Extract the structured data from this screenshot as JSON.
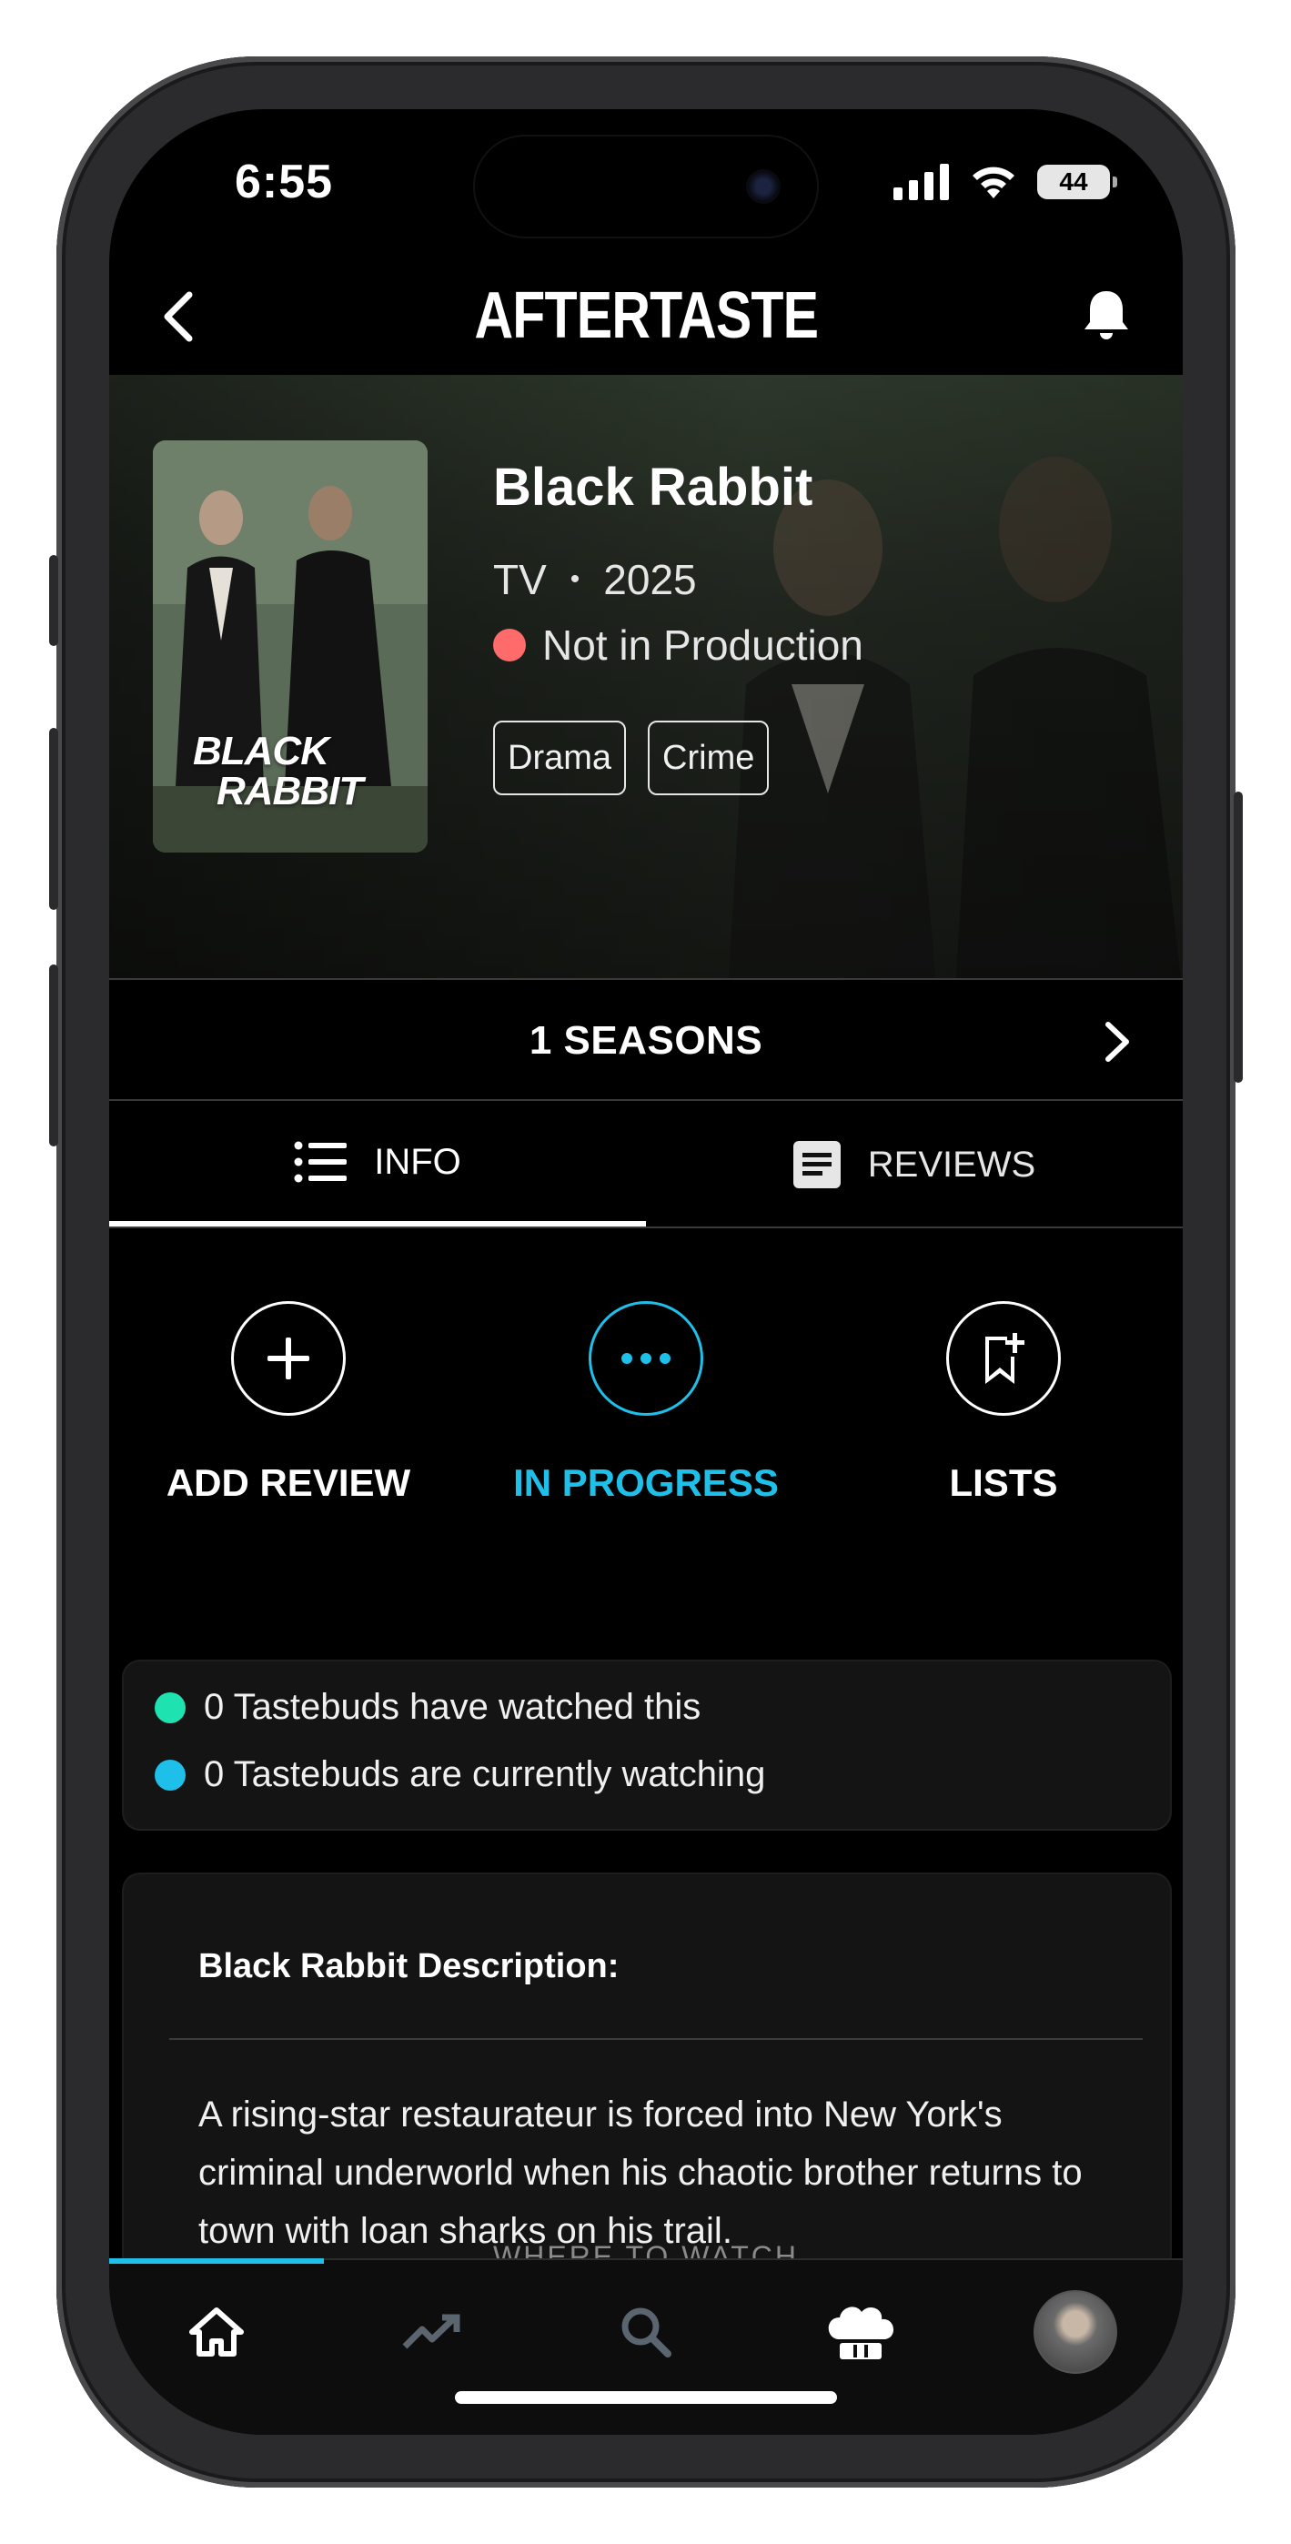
{
  "status_bar": {
    "time": "6:55",
    "battery": "44"
  },
  "header": {
    "title": "AFTERTASTE",
    "back_icon": "chevron-left-icon",
    "bell_icon": "bell-icon"
  },
  "show": {
    "title": "Black Rabbit",
    "type": "TV",
    "separator": "•",
    "year": "2025",
    "production_status": "Not in Production",
    "status_color": "#ff6b6b",
    "genres": [
      "Drama",
      "Crime"
    ],
    "poster_title_line1": "BLACK",
    "poster_title_line2": "RABBIT"
  },
  "seasons": {
    "label": "1 SEASONS"
  },
  "tabs": [
    {
      "label": "INFO",
      "icon": "list-icon",
      "active": true
    },
    {
      "label": "REVIEWS",
      "icon": "document-icon",
      "active": false
    }
  ],
  "actions": [
    {
      "label": "ADD REVIEW",
      "icon": "plus-icon"
    },
    {
      "label": "IN PROGRESS",
      "icon": "more-dots-icon",
      "color": "#1ec0ea"
    },
    {
      "label": "LISTS",
      "icon": "bookmark-add-icon"
    }
  ],
  "tastebuds": [
    {
      "text": "0 Tastebuds have watched this",
      "color": "#1ee3b0"
    },
    {
      "text": "0 Tastebuds are currently watching",
      "color": "#1ec0ea"
    }
  ],
  "description": {
    "title": "Black Rabbit Description:",
    "text": "A rising-star restaurateur is forced into New York's criminal underworld when his chaotic brother returns to town with loan sharks on his trail.",
    "where_to_watch": "WHERE TO WATCH"
  },
  "bottom_nav": {
    "items": [
      "home-icon",
      "trending-icon",
      "search-icon",
      "chef-hat-icon",
      "avatar"
    ]
  }
}
